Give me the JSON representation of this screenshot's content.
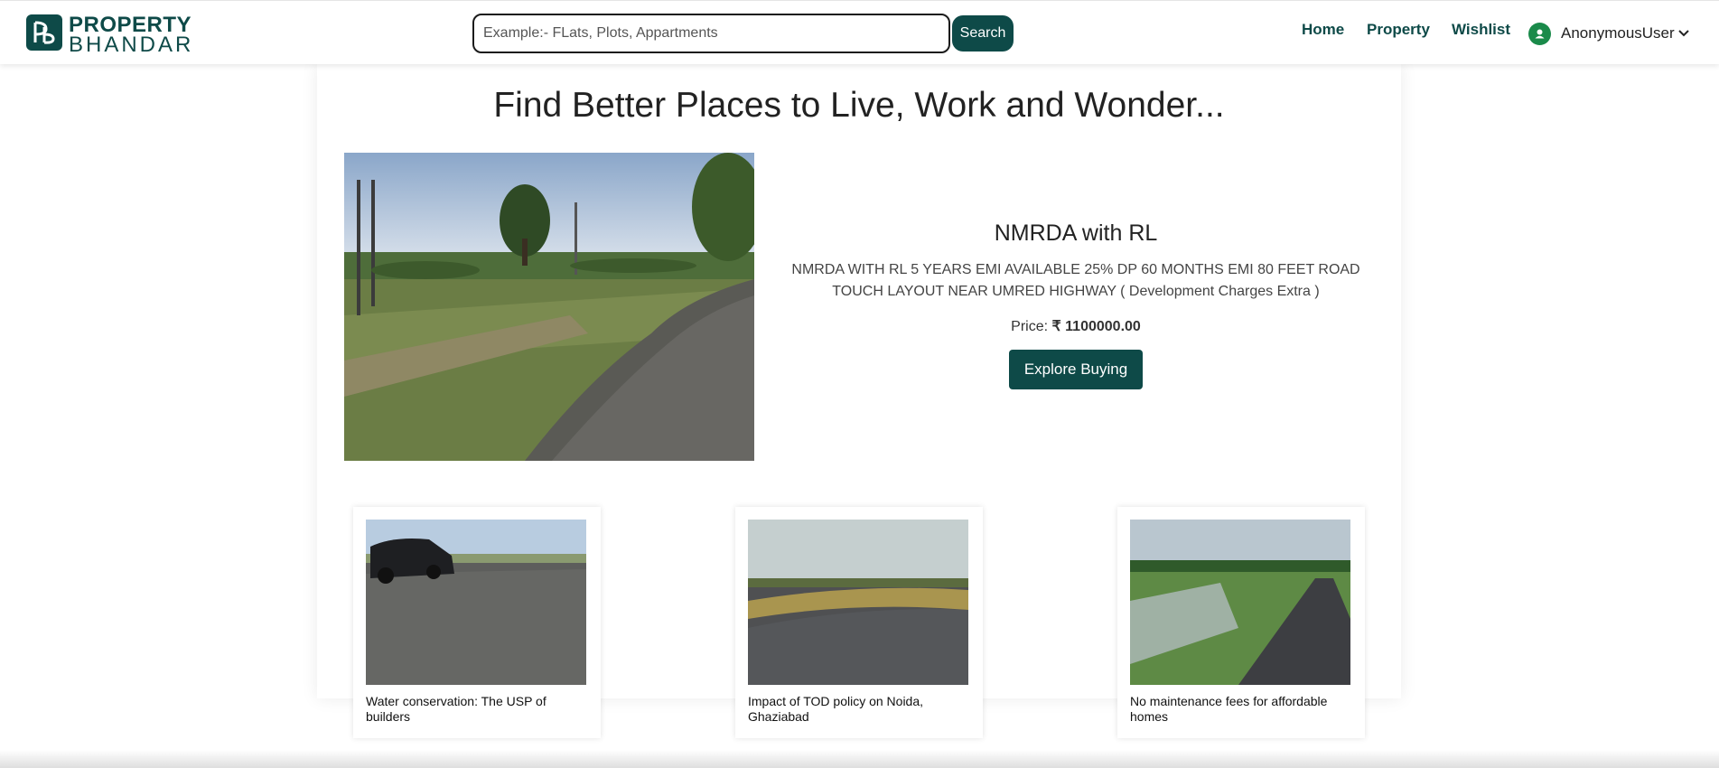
{
  "header": {
    "logo_line1": "PROPERTY",
    "logo_line2": "BHANDAR",
    "search_placeholder": "Example:- FLats, Plots, Appartments",
    "search_button": "Search",
    "nav": [
      "Home",
      "Property",
      "Wishlist"
    ],
    "user_name": "AnonymousUser"
  },
  "hero": {
    "title": "Find Better Places to Live, Work and Wonder...",
    "property_title": "NMRDA with RL",
    "description": "NMRDA WITH RL 5 YEARS EMI AVAILABLE 25% DP 60 MONTHS EMI 80 FEET ROAD TOUCH LAYOUT NEAR UMRED HIGHWAY ( Development Charges Extra )",
    "price_label": "Price:",
    "price_value": "₹ 1100000.00",
    "cta": "Explore Buying"
  },
  "blogs": [
    {
      "caption": "Water conservation: The USP of builders"
    },
    {
      "caption": "Impact of TOD policy on Noida, Ghaziabad"
    },
    {
      "caption": "No maintenance fees for affordable homes"
    }
  ],
  "colors": {
    "brand": "#0e4a48",
    "avatar": "#1a8a4a"
  }
}
